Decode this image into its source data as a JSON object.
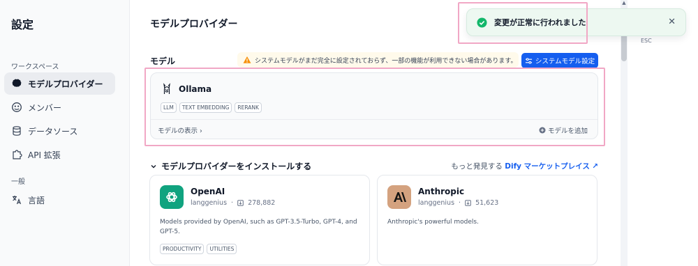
{
  "sidebar": {
    "title": "設定",
    "workspace_label": "ワークスペース",
    "general_label": "一般",
    "items": [
      {
        "label": "モデルプロバイダー"
      },
      {
        "label": "メンバー"
      },
      {
        "label": "データソース"
      },
      {
        "label": "API 拡張"
      },
      {
        "label": "言語"
      }
    ]
  },
  "main": {
    "title": "モデルプロバイダー",
    "model_section_label": "モデル",
    "warning_text": "システムモデルがまだ完全に設定されておらず、一部の機能が利用できない場合があります。",
    "system_model_button": "システムモデル設定",
    "provider": {
      "name": "Ollama",
      "tags": [
        "LLM",
        "TEXT EMBEDDING",
        "RERANK"
      ],
      "show_models": "モデルの表示",
      "add_model": "モデルを追加"
    },
    "install_section": {
      "title": "モデルプロバイダーをインストールする",
      "discover_prefix": "もっと発見する",
      "discover_link": "Dify マーケットプレイス"
    },
    "plugins": [
      {
        "name": "OpenAI",
        "author": "langgenius",
        "installs": "278,882",
        "description": "Models provided by OpenAI, such as GPT-3.5-Turbo, GPT-4, and GPT-5.",
        "tags": [
          "PRODUCTIVITY",
          "UTILITIES"
        ]
      },
      {
        "name": "Anthropic",
        "author": "langgenius",
        "installs": "51,623",
        "description": "Anthropic's powerful models.",
        "tags": []
      }
    ]
  },
  "toast": {
    "message": "変更が正常に行われました"
  },
  "rail": {
    "esc_label": "ESC"
  },
  "colors": {
    "accent": "#155eef",
    "success": "#12b76a",
    "warning": "#f79009",
    "highlight": "#f1a7c5"
  }
}
